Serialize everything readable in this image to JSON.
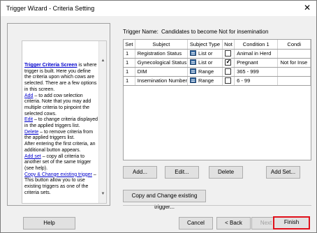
{
  "window": {
    "title": "Trigger Wizard - Criteria Setting",
    "close_glyph": "✕"
  },
  "help": {
    "intro_bold": "Trigger Criteria Screen",
    "intro_rest": " is where trigger is built. Here you define the criteria upon which cows are selected. There are a few options in this screen.",
    "add_link": "Add",
    "add_desc": " – to add cow selection criteria. Note that you may add multiple criteria to pinpoint the selected cows.",
    "edit_link": "Edit",
    "edit_desc": " – to change criteria displayed in the applied triggers list.",
    "delete_link": "Delete",
    "delete_desc": " – to remove criteria from the applied triggers list.",
    "after_first": "After entering the first criteria, an additional button appears.",
    "addset_link": "Add set",
    "addset_desc": " – copy all criteria to another set of the same trigger (see help).",
    "copy_link": "Copy & Change existing trigger",
    "copy_desc": " – This button allow you to use existing triggers as one of the criteria sets."
  },
  "trigger": {
    "name_label": "Trigger Name:",
    "name_value": "Candidates to become Not for insemination"
  },
  "grid": {
    "columns": [
      "Set",
      "Subject",
      "Subject Type",
      "Not",
      "Condition 1",
      "Condi"
    ],
    "rows": [
      {
        "set": "1",
        "subject": "Registration Status",
        "type": "List or",
        "not": false,
        "cond1": "Animal in Herd",
        "cond2": ""
      },
      {
        "set": "1",
        "subject": "Gynecological Status",
        "type": "List or",
        "not": true,
        "cond1": "Pregnant",
        "cond2": "Not for Inse"
      },
      {
        "set": "1",
        "subject": "DIM",
        "type": "Range",
        "not": false,
        "cond1": "365 - 999",
        "cond2": ""
      },
      {
        "set": "1",
        "subject": "Insemination Number",
        "type": "Range",
        "not": false,
        "cond1": "6 - 99",
        "cond2": ""
      }
    ]
  },
  "buttons": {
    "add": "Add...",
    "edit": "Edit...",
    "delete": "Delete",
    "add_set": "Add Set...",
    "copy_change": "Copy and Change existing trigger...",
    "help": "Help",
    "cancel": "Cancel",
    "back": "< Back",
    "next": "Next >",
    "finish": "Finish"
  }
}
